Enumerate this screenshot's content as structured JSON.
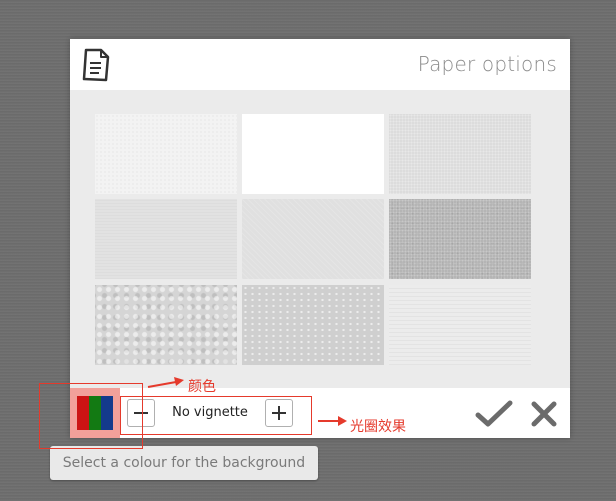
{
  "dialog": {
    "title": "Paper options",
    "header_icon": "document-icon"
  },
  "paper_grid": {
    "tiles": [
      {
        "id": "paper-white-fibre"
      },
      {
        "id": "paper-plain-white"
      },
      {
        "id": "paper-light-grain"
      },
      {
        "id": "paper-soft-lines"
      },
      {
        "id": "paper-smooth-grey"
      },
      {
        "id": "paper-speckled-grey"
      },
      {
        "id": "paper-crumpled"
      },
      {
        "id": "paper-dotted-grey"
      },
      {
        "id": "paper-lined-light"
      }
    ]
  },
  "toolbar": {
    "colour_swatch": {
      "colors": [
        "#cc1414",
        "#137a13",
        "#143a8c"
      ],
      "background": "#f2a09a"
    },
    "vignette_label": "No vignette",
    "decrease_icon": "minus-icon",
    "increase_icon": "plus-icon",
    "confirm_icon": "checkmark-icon",
    "cancel_icon": "close-icon"
  },
  "tooltip": {
    "text": "Select a colour for the background"
  },
  "annotations": {
    "color_label": "颜色",
    "vignette_effect_label": "光圈效果",
    "accent_color": "#e53a2c"
  }
}
